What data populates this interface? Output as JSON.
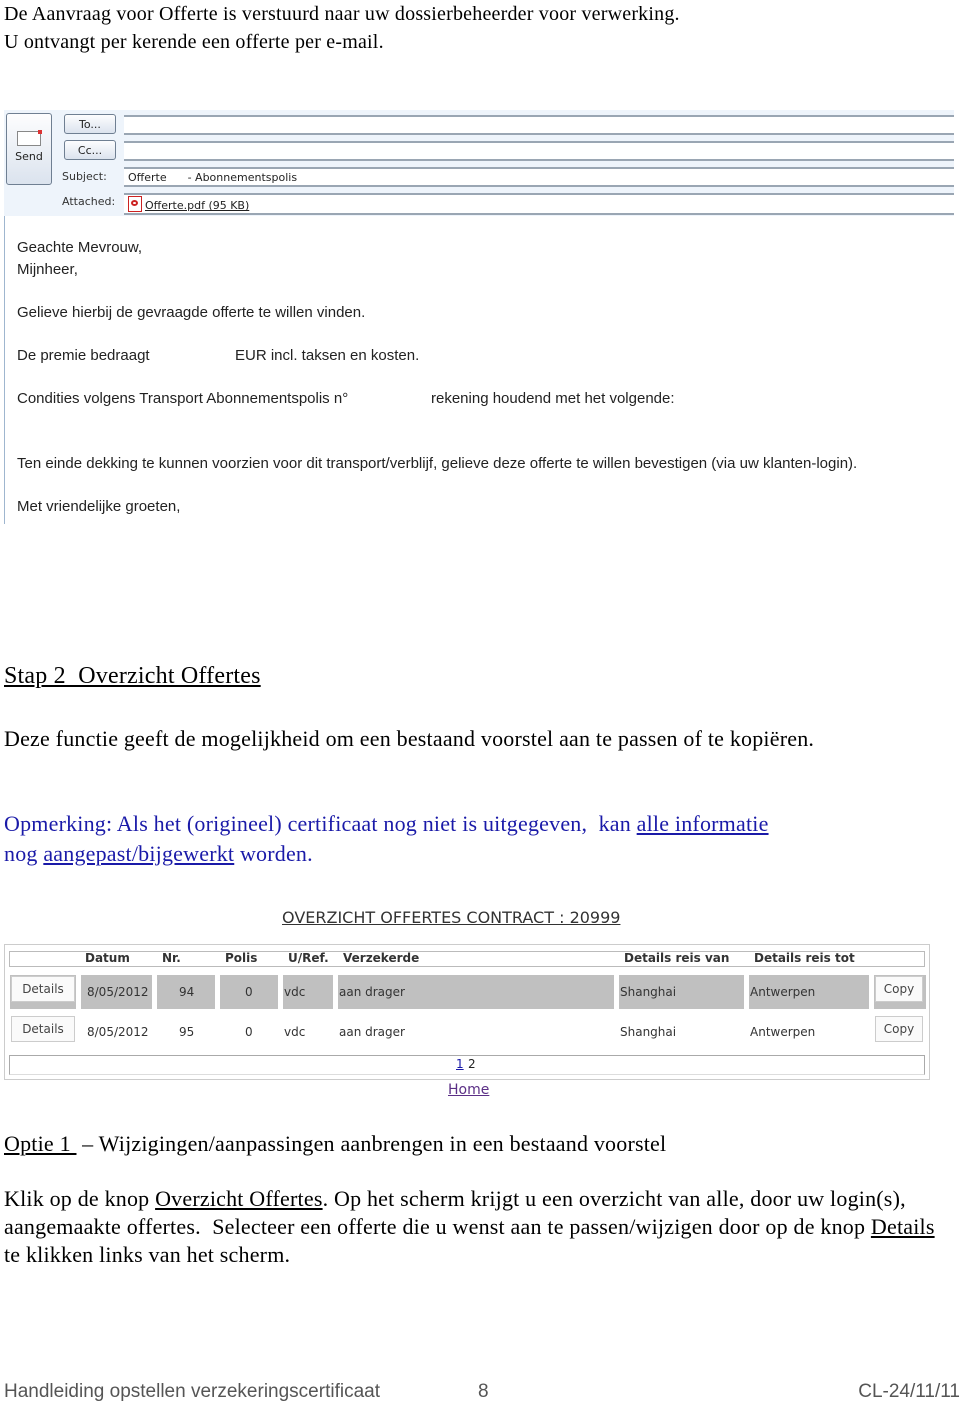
{
  "intro": {
    "line1": "De Aanvraag voor Offerte is verstuurd naar uw dossierbeheerder voor verwerking.",
    "line2": "U ontvangt per kerende een offerte per e-mail."
  },
  "email": {
    "send_label": "Send",
    "to_label": "To...",
    "cc_label": "Cc...",
    "subject_label": "Subject:",
    "attached_label": "Attached:",
    "to_value": "",
    "cc_value": "",
    "subject_value": "Offerte      - Abonnementspolis",
    "attachment": "Offerte.pdf (95 KB)",
    "body": {
      "greeting1": "Geachte Mevrouw,",
      "greeting2": "Mijnheer,",
      "line1": "Gelieve hierbij de gevraagde offerte te willen vinden.",
      "premie_a": "De premie bedraagt",
      "premie_b": "EUR incl. taksen en kosten.",
      "condities_a": "Condities volgens Transport Abonnementspolis n°",
      "condities_b": "rekening houdend met het volgende:",
      "line_dekking": "Ten einde dekking te kunnen voorzien voor dit transport/verblijf, gelieve deze offerte te willen bevestigen (via uw klanten-login).",
      "closing": "Met vriendelijke groeten,"
    }
  },
  "section": {
    "heading": "Stap 2  Overzicht Offertes",
    "description": "Deze functie geeft de mogelijkheid om een bestaand voorstel aan te passen of te kopiëren.",
    "note_prefix": "Opmerking: Als het (origineel) certificaat nog niet is uitgegeven,  kan ",
    "note_link1": "alle informatie",
    "note_mid": "nog ",
    "note_link2": "aangepast/bijgewerkt",
    "note_suffix": " worden."
  },
  "overview": {
    "title": "OVERZICHT OFFERTES CONTRACT : 20999",
    "columns": [
      "Datum",
      "Nr.",
      "Polis",
      "U/Ref.",
      "Verzekerde",
      "Details reis van",
      "Details reis tot"
    ],
    "details_label": "Details",
    "copy_label": "Copy",
    "rows": [
      {
        "datum": "8/05/2012",
        "nr": "94",
        "polis": "0",
        "ref": "vdc",
        "verzekerde": "aan drager",
        "van": "Shanghai",
        "tot": "Antwerpen"
      },
      {
        "datum": "8/05/2012",
        "nr": "95",
        "polis": "0",
        "ref": "vdc",
        "verzekerde": "aan drager",
        "van": "Shanghai",
        "tot": "Antwerpen"
      }
    ],
    "pages": [
      "1",
      "2"
    ],
    "home_link": "Home"
  },
  "optie": {
    "label": "Optie 1 ",
    "dash_title": " – Wijzigingen/aanpassingen aanbrengen in een bestaand voorstel",
    "p1_a": "Klik op de knop ",
    "p1_link": "Overzicht Offertes",
    "p1_b": ". Op het scherm krijgt u een overzicht van alle, door uw login(s), aangemaakte offertes.  Selecteer een offerte die u wenst aan te passen/wijzigen door op de knop ",
    "p1_link2": "Details",
    "p1_c": " te klikken links van het scherm."
  },
  "footer": {
    "title": "Handleiding opstellen verzekeringscertificaat",
    "page": "8",
    "code": "CL-24/11/11"
  }
}
